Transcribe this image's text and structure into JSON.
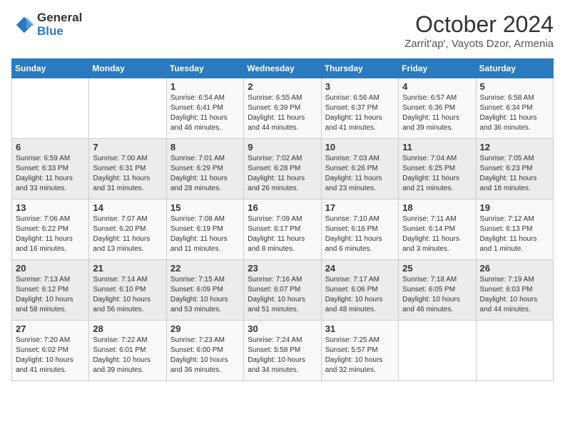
{
  "header": {
    "logo_general": "General",
    "logo_blue": "Blue",
    "month_title": "October 2024",
    "location": "Zarrit'ap', Vayots Dzor, Armenia"
  },
  "weekdays": [
    "Sunday",
    "Monday",
    "Tuesday",
    "Wednesday",
    "Thursday",
    "Friday",
    "Saturday"
  ],
  "weeks": [
    [
      {
        "day": "",
        "info": ""
      },
      {
        "day": "",
        "info": ""
      },
      {
        "day": "1",
        "info": "Sunrise: 6:54 AM\nSunset: 6:41 PM\nDaylight: 11 hours and 46 minutes."
      },
      {
        "day": "2",
        "info": "Sunrise: 6:55 AM\nSunset: 6:39 PM\nDaylight: 11 hours and 44 minutes."
      },
      {
        "day": "3",
        "info": "Sunrise: 6:56 AM\nSunset: 6:37 PM\nDaylight: 11 hours and 41 minutes."
      },
      {
        "day": "4",
        "info": "Sunrise: 6:57 AM\nSunset: 6:36 PM\nDaylight: 11 hours and 39 minutes."
      },
      {
        "day": "5",
        "info": "Sunrise: 6:58 AM\nSunset: 6:34 PM\nDaylight: 11 hours and 36 minutes."
      }
    ],
    [
      {
        "day": "6",
        "info": "Sunrise: 6:59 AM\nSunset: 6:33 PM\nDaylight: 11 hours and 33 minutes."
      },
      {
        "day": "7",
        "info": "Sunrise: 7:00 AM\nSunset: 6:31 PM\nDaylight: 11 hours and 31 minutes."
      },
      {
        "day": "8",
        "info": "Sunrise: 7:01 AM\nSunset: 6:29 PM\nDaylight: 11 hours and 28 minutes."
      },
      {
        "day": "9",
        "info": "Sunrise: 7:02 AM\nSunset: 6:28 PM\nDaylight: 11 hours and 26 minutes."
      },
      {
        "day": "10",
        "info": "Sunrise: 7:03 AM\nSunset: 6:26 PM\nDaylight: 11 hours and 23 minutes."
      },
      {
        "day": "11",
        "info": "Sunrise: 7:04 AM\nSunset: 6:25 PM\nDaylight: 11 hours and 21 minutes."
      },
      {
        "day": "12",
        "info": "Sunrise: 7:05 AM\nSunset: 6:23 PM\nDaylight: 11 hours and 18 minutes."
      }
    ],
    [
      {
        "day": "13",
        "info": "Sunrise: 7:06 AM\nSunset: 6:22 PM\nDaylight: 11 hours and 16 minutes."
      },
      {
        "day": "14",
        "info": "Sunrise: 7:07 AM\nSunset: 6:20 PM\nDaylight: 11 hours and 13 minutes."
      },
      {
        "day": "15",
        "info": "Sunrise: 7:08 AM\nSunset: 6:19 PM\nDaylight: 11 hours and 11 minutes."
      },
      {
        "day": "16",
        "info": "Sunrise: 7:09 AM\nSunset: 6:17 PM\nDaylight: 11 hours and 8 minutes."
      },
      {
        "day": "17",
        "info": "Sunrise: 7:10 AM\nSunset: 6:16 PM\nDaylight: 11 hours and 6 minutes."
      },
      {
        "day": "18",
        "info": "Sunrise: 7:11 AM\nSunset: 6:14 PM\nDaylight: 11 hours and 3 minutes."
      },
      {
        "day": "19",
        "info": "Sunrise: 7:12 AM\nSunset: 6:13 PM\nDaylight: 11 hours and 1 minute."
      }
    ],
    [
      {
        "day": "20",
        "info": "Sunrise: 7:13 AM\nSunset: 6:12 PM\nDaylight: 10 hours and 58 minutes."
      },
      {
        "day": "21",
        "info": "Sunrise: 7:14 AM\nSunset: 6:10 PM\nDaylight: 10 hours and 56 minutes."
      },
      {
        "day": "22",
        "info": "Sunrise: 7:15 AM\nSunset: 6:09 PM\nDaylight: 10 hours and 53 minutes."
      },
      {
        "day": "23",
        "info": "Sunrise: 7:16 AM\nSunset: 6:07 PM\nDaylight: 10 hours and 51 minutes."
      },
      {
        "day": "24",
        "info": "Sunrise: 7:17 AM\nSunset: 6:06 PM\nDaylight: 10 hours and 48 minutes."
      },
      {
        "day": "25",
        "info": "Sunrise: 7:18 AM\nSunset: 6:05 PM\nDaylight: 10 hours and 46 minutes."
      },
      {
        "day": "26",
        "info": "Sunrise: 7:19 AM\nSunset: 6:03 PM\nDaylight: 10 hours and 44 minutes."
      }
    ],
    [
      {
        "day": "27",
        "info": "Sunrise: 7:20 AM\nSunset: 6:02 PM\nDaylight: 10 hours and 41 minutes."
      },
      {
        "day": "28",
        "info": "Sunrise: 7:22 AM\nSunset: 6:01 PM\nDaylight: 10 hours and 39 minutes."
      },
      {
        "day": "29",
        "info": "Sunrise: 7:23 AM\nSunset: 6:00 PM\nDaylight: 10 hours and 36 minutes."
      },
      {
        "day": "30",
        "info": "Sunrise: 7:24 AM\nSunset: 5:58 PM\nDaylight: 10 hours and 34 minutes."
      },
      {
        "day": "31",
        "info": "Sunrise: 7:25 AM\nSunset: 5:57 PM\nDaylight: 10 hours and 32 minutes."
      },
      {
        "day": "",
        "info": ""
      },
      {
        "day": "",
        "info": ""
      }
    ]
  ]
}
